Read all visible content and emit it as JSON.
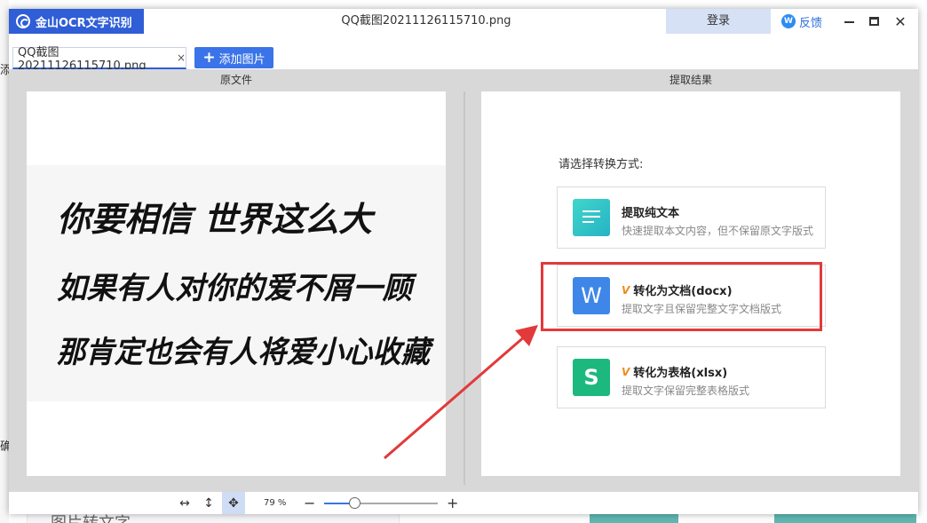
{
  "background": {
    "left_chars": [
      "添",
      "确"
    ],
    "bottom_card_text": "图片转文字"
  },
  "titlebar": {
    "app_name": "金山OCR文字识别",
    "window_title": "QQ截图20211126115710.png",
    "login_label": "登录",
    "feedback_label": "反馈",
    "close_glyph": "✕"
  },
  "tabbar": {
    "file_tab_label": "QQ截图20211126115710.png",
    "file_tab_close": "×",
    "add_label": "添加图片",
    "add_glyph": "+"
  },
  "panes": {
    "left_title": "原文件",
    "right_title": "提取结果"
  },
  "document": {
    "lines": [
      "你要相信 世界这么大",
      "如果有人对你的爱不屑一顾",
      "那肯定也会有人将爱小心收藏"
    ]
  },
  "convert": {
    "prompt": "请选择转换方式:",
    "options": [
      {
        "title": "提取纯文本",
        "desc": "快速提取本文内容，但不保留原文字版式",
        "icon": "text-lines-icon",
        "vip": false
      },
      {
        "title": "转化为文档(docx)",
        "desc": "提取文字且保留完整文字文档版式",
        "icon": "word-doc-icon",
        "icon_glyph": "W",
        "vip": true,
        "vip_glyph": "V",
        "highlighted": true
      },
      {
        "title": "转化为表格(xlsx)",
        "desc": "提取文字保留完整表格版式",
        "icon": "sheet-icon",
        "icon_glyph": "S",
        "vip": true,
        "vip_glyph": "V"
      }
    ]
  },
  "bottombar": {
    "fit_width_glyph": "↔",
    "fit_height_glyph": "↕",
    "move_glyph": "✥",
    "zoom_label": "79 %",
    "zoom_percent": 79,
    "minus_glyph": "−",
    "plus_glyph": "+"
  },
  "colors": {
    "brand": "#2f5ed6",
    "highlight": "#e23a3a",
    "word_icon": "#3f86e9",
    "sheet_icon": "#1db87e",
    "vip": "#f08a1b"
  }
}
